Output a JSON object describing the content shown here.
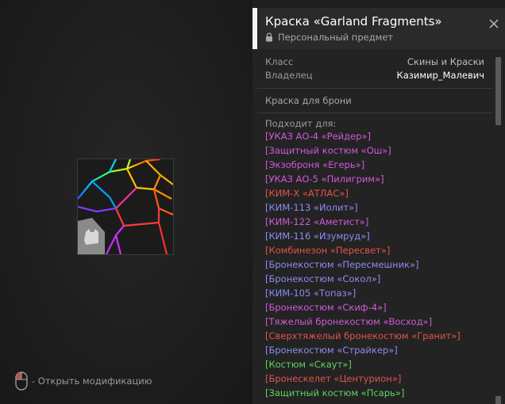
{
  "preview": {
    "hint_text": "- Открыть модификацию"
  },
  "item": {
    "title": "Краска «Garland Fragments»",
    "subtitle": "Персональный предмет"
  },
  "details": {
    "class_label": "Класс",
    "class_value": "Скины и Краски",
    "owner_label": "Владелец",
    "owner_value": "Казимир_Малевич",
    "type_text": "Краска для брони",
    "fits_label": "Подходит для:"
  },
  "fits": [
    {
      "name": "[УКАЗ АО-4 «Рейдер»]",
      "color": "#d05ad8"
    },
    {
      "name": "[Защитный костюм «Ош»]",
      "color": "#d05ad8"
    },
    {
      "name": "[Экзоброня «Егерь»]",
      "color": "#d05ad8"
    },
    {
      "name": "[УКАЗ АО-5 «Пилигрим»]",
      "color": "#d05ad8"
    },
    {
      "name": "[КИМ-Х «АТЛАС»]",
      "color": "#e2534a"
    },
    {
      "name": "[КИМ-113 «Иолит»]",
      "color": "#8c8cf0"
    },
    {
      "name": "[КИМ-122 «Аметист»]",
      "color": "#d05ad8"
    },
    {
      "name": "[КИМ-116 «Изумруд»]",
      "color": "#8c8cf0"
    },
    {
      "name": "[Комбинезон «Пересвет»]",
      "color": "#e2534a"
    },
    {
      "name": "[Бронекостюм «Пересмешник»]",
      "color": "#8c8cf0"
    },
    {
      "name": "[Бронекостюм «Сокол»]",
      "color": "#8c8cf0"
    },
    {
      "name": "[КИМ-105 «Топаз»]",
      "color": "#8c8cf0"
    },
    {
      "name": "[Бронекостюм «Скиф-4»]",
      "color": "#d05ad8"
    },
    {
      "name": "[Тяжелый бронекостюм «Восход»]",
      "color": "#d05ad8"
    },
    {
      "name": "[Сверхтяжелый бронекостюм «Гранит»]",
      "color": "#e2534a"
    },
    {
      "name": "[Бронекостюм «Страйкер»]",
      "color": "#8c8cf0"
    },
    {
      "name": "[Костюм «Скаут»]",
      "color": "#5fd35f"
    },
    {
      "name": "[Бронескелет «Центурион»]",
      "color": "#e2534a"
    },
    {
      "name": "[Защитный костюм «Псарь»]",
      "color": "#5fd35f"
    }
  ],
  "icons": {
    "mouse": "mouse-icon",
    "lock": "lock-icon",
    "close": "close-icon",
    "item_thumbnail": "paint-swatch-icon"
  }
}
